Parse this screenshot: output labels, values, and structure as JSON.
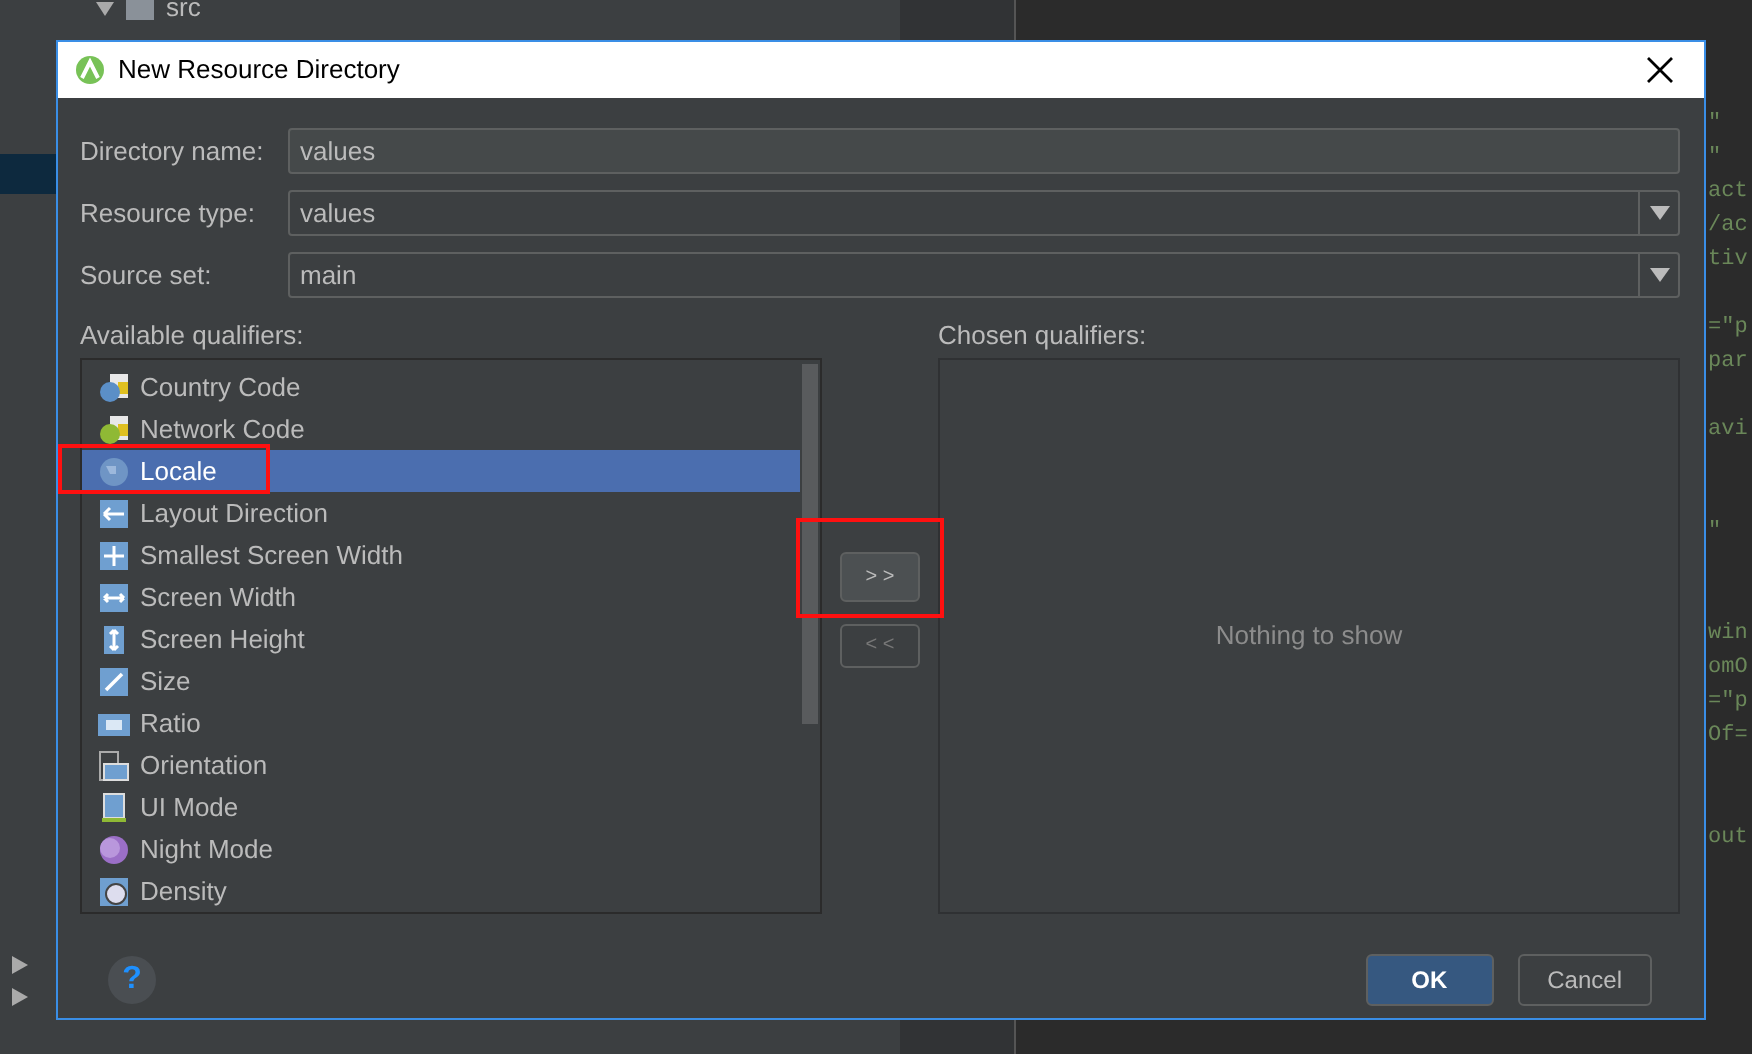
{
  "ide": {
    "tree_items": [
      {
        "label": "src",
        "expanded": true
      }
    ],
    "code_blocks": [
      [
        "\"",
        "\"",
        "act",
        "/ac",
        "tiv"
      ],
      [
        "=\"p",
        "par"
      ],
      [
        "avi"
      ],
      [
        "\""
      ],
      [
        "win",
        "omO",
        "=\"p",
        "Of="
      ],
      [
        "out"
      ]
    ]
  },
  "dialog": {
    "title": "New Resource Directory",
    "fields": [
      {
        "label": "Directory name:",
        "value": "values",
        "kind": "text"
      },
      {
        "label": "Resource type:",
        "value": "values",
        "kind": "combo"
      },
      {
        "label": "Source set:",
        "value": "main",
        "kind": "combo"
      }
    ],
    "available_label": "Available qualifiers:",
    "available": [
      {
        "label": "Country Code",
        "selected": false,
        "annotated": false
      },
      {
        "label": "Network Code",
        "selected": false,
        "annotated": false
      },
      {
        "label": "Locale",
        "selected": true,
        "annotated": true
      },
      {
        "label": "Layout Direction",
        "selected": false,
        "annotated": false
      },
      {
        "label": "Smallest Screen Width",
        "selected": false,
        "annotated": false
      },
      {
        "label": "Screen Width",
        "selected": false,
        "annotated": false
      },
      {
        "label": "Screen Height",
        "selected": false,
        "annotated": false
      },
      {
        "label": "Size",
        "selected": false,
        "annotated": false
      },
      {
        "label": "Ratio",
        "selected": false,
        "annotated": false
      },
      {
        "label": "Orientation",
        "selected": false,
        "annotated": false
      },
      {
        "label": "UI Mode",
        "selected": false,
        "annotated": false
      },
      {
        "label": "Night Mode",
        "selected": false,
        "annotated": false
      },
      {
        "label": "Density",
        "selected": false,
        "annotated": false
      }
    ],
    "move_buttons": [
      {
        "label": "> >",
        "disabled": false,
        "annotated": true
      },
      {
        "label": "< <",
        "disabled": true,
        "annotated": false
      }
    ],
    "chosen_label": "Chosen qualifiers:",
    "chosen_empty": "Nothing to show",
    "help": "?",
    "buttons": [
      {
        "label": "OK",
        "default": true
      },
      {
        "label": "Cancel",
        "default": false
      }
    ]
  }
}
